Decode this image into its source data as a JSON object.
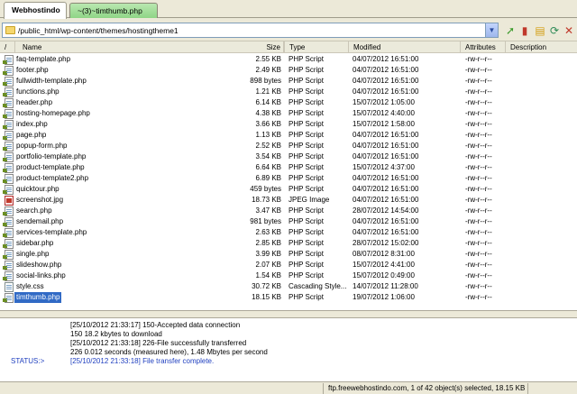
{
  "tabs": [
    {
      "label": "Webhostindo"
    },
    {
      "label": "~(3)~timthumb.php"
    }
  ],
  "path": {
    "value": "/public_html/wp-content/themes/hostingtheme1"
  },
  "columns": {
    "name": "Name",
    "size": "Size",
    "type": "Type",
    "modified": "Modified",
    "attributes": "Attributes",
    "description": "Description",
    "up": "/"
  },
  "toolbar_icons": [
    "go-up-icon",
    "delete-icon",
    "properties-icon",
    "refresh-icon",
    "close-icon"
  ],
  "files": [
    {
      "name": "faq-template.php",
      "size": "2.55 KB",
      "type": "PHP Script",
      "modified": "04/07/2012 16:51:00",
      "attributes": "-rw-r--r--",
      "icon": "php-file-icon"
    },
    {
      "name": "footer.php",
      "size": "2.49 KB",
      "type": "PHP Script",
      "modified": "04/07/2012 16:51:00",
      "attributes": "-rw-r--r--",
      "icon": "php-file-icon"
    },
    {
      "name": "fullwidth-template.php",
      "size": "898 bytes",
      "type": "PHP Script",
      "modified": "04/07/2012 16:51:00",
      "attributes": "-rw-r--r--",
      "icon": "php-file-icon"
    },
    {
      "name": "functions.php",
      "size": "1.21 KB",
      "type": "PHP Script",
      "modified": "04/07/2012 16:51:00",
      "attributes": "-rw-r--r--",
      "icon": "php-file-icon"
    },
    {
      "name": "header.php",
      "size": "6.14 KB",
      "type": "PHP Script",
      "modified": "15/07/2012 1:05:00",
      "attributes": "-rw-r--r--",
      "icon": "php-file-icon"
    },
    {
      "name": "hosting-homepage.php",
      "size": "4.38 KB",
      "type": "PHP Script",
      "modified": "15/07/2012 4:40:00",
      "attributes": "-rw-r--r--",
      "icon": "php-file-icon"
    },
    {
      "name": "index.php",
      "size": "3.66 KB",
      "type": "PHP Script",
      "modified": "15/07/2012 1:58:00",
      "attributes": "-rw-r--r--",
      "icon": "php-file-icon"
    },
    {
      "name": "page.php",
      "size": "1.13 KB",
      "type": "PHP Script",
      "modified": "04/07/2012 16:51:00",
      "attributes": "-rw-r--r--",
      "icon": "php-file-icon"
    },
    {
      "name": "popup-form.php",
      "size": "2.52 KB",
      "type": "PHP Script",
      "modified": "04/07/2012 16:51:00",
      "attributes": "-rw-r--r--",
      "icon": "php-file-icon"
    },
    {
      "name": "portfolio-template.php",
      "size": "3.54 KB",
      "type": "PHP Script",
      "modified": "04/07/2012 16:51:00",
      "attributes": "-rw-r--r--",
      "icon": "php-file-icon"
    },
    {
      "name": "product-template.php",
      "size": "6.64 KB",
      "type": "PHP Script",
      "modified": "15/07/2012 4:37:00",
      "attributes": "-rw-r--r--",
      "icon": "php-file-icon"
    },
    {
      "name": "product-template2.php",
      "size": "6.89 KB",
      "type": "PHP Script",
      "modified": "04/07/2012 16:51:00",
      "attributes": "-rw-r--r--",
      "icon": "php-file-icon"
    },
    {
      "name": "quicktour.php",
      "size": "459 bytes",
      "type": "PHP Script",
      "modified": "04/07/2012 16:51:00",
      "attributes": "-rw-r--r--",
      "icon": "php-file-icon"
    },
    {
      "name": "screenshot.jpg",
      "size": "18.73 KB",
      "type": "JPEG Image",
      "modified": "04/07/2012 16:51:00",
      "attributes": "-rw-r--r--",
      "icon": "jpeg-file-icon"
    },
    {
      "name": "search.php",
      "size": "3.47 KB",
      "type": "PHP Script",
      "modified": "28/07/2012 14:54:00",
      "attributes": "-rw-r--r--",
      "icon": "php-file-icon"
    },
    {
      "name": "sendemail.php",
      "size": "981 bytes",
      "type": "PHP Script",
      "modified": "04/07/2012 16:51:00",
      "attributes": "-rw-r--r--",
      "icon": "php-file-icon"
    },
    {
      "name": "services-template.php",
      "size": "2.63 KB",
      "type": "PHP Script",
      "modified": "04/07/2012 16:51:00",
      "attributes": "-rw-r--r--",
      "icon": "php-file-icon"
    },
    {
      "name": "sidebar.php",
      "size": "2.85 KB",
      "type": "PHP Script",
      "modified": "28/07/2012 15:02:00",
      "attributes": "-rw-r--r--",
      "icon": "php-file-icon"
    },
    {
      "name": "single.php",
      "size": "3.99 KB",
      "type": "PHP Script",
      "modified": "08/07/2012 8:31:00",
      "attributes": "-rw-r--r--",
      "icon": "php-file-icon"
    },
    {
      "name": "slideshow.php",
      "size": "2.07 KB",
      "type": "PHP Script",
      "modified": "15/07/2012 4:41:00",
      "attributes": "-rw-r--r--",
      "icon": "php-file-icon"
    },
    {
      "name": "social-links.php",
      "size": "1.54 KB",
      "type": "PHP Script",
      "modified": "15/07/2012 0:49:00",
      "attributes": "-rw-r--r--",
      "icon": "php-file-icon"
    },
    {
      "name": "style.css",
      "size": "30.72 KB",
      "type": "Cascading Style...",
      "modified": "14/07/2012 11:28:00",
      "attributes": "-rw-r--r--",
      "icon": "css-file-icon"
    },
    {
      "name": "timthumb.php",
      "size": "18.15 KB",
      "type": "PHP Script",
      "modified": "19/07/2012 1:06:00",
      "attributes": "-rw-r--r--",
      "icon": "php-file-icon",
      "selected": true
    }
  ],
  "log": [
    {
      "text": "[25/10/2012 21:33:17] 150-Accepted data connection",
      "color": "black"
    },
    {
      "text": "150 18.2 kbytes to download",
      "color": "black"
    },
    {
      "text": "[25/10/2012 21:33:18] 226-File successfully transferred",
      "color": "black"
    },
    {
      "text": "226 0.012 seconds (measured here), 1.48 Mbytes per second",
      "color": "black"
    },
    {
      "text": "[25/10/2012 21:33:18] File transfer complete.",
      "color": "blue"
    }
  ],
  "status_label": "STATUS:>",
  "statusbar": {
    "text": "ftp.freewebhostindo.com, 1 of 42 object(s) selected, 18.15 KB"
  },
  "colors": {
    "selection": "#316ac5",
    "status_blue": "#1f3fbf",
    "tab_inactive": "#8fd586"
  }
}
